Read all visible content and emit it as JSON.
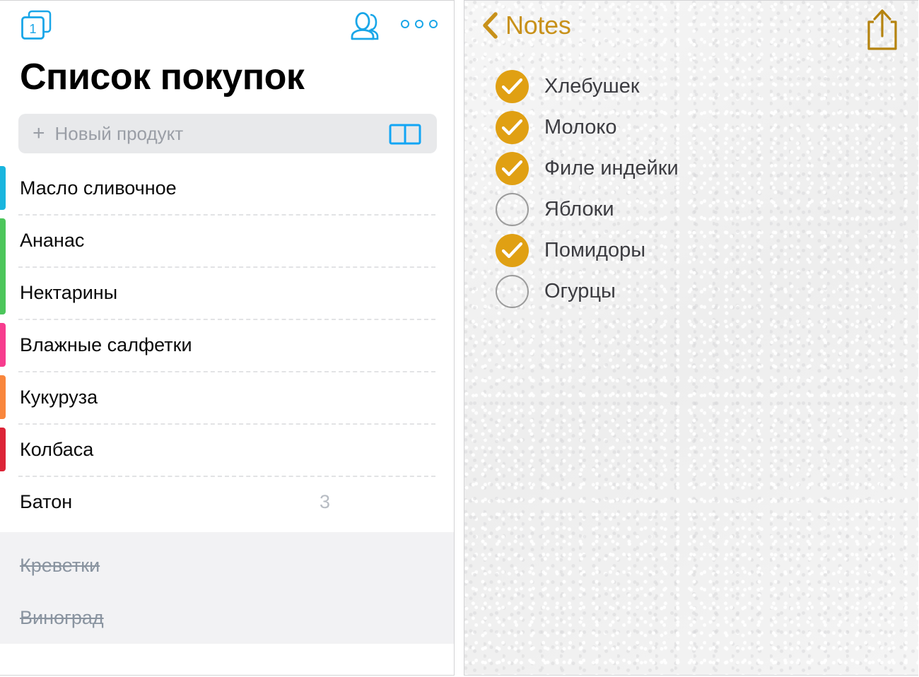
{
  "shopping_list": {
    "toolbar": {
      "stack_icon": "list-stack-icon",
      "stack_badge": "1",
      "people_icon": "people-icon",
      "more_icon": "more-options-icon"
    },
    "title": "Список покупок",
    "new_item": {
      "plus": "+",
      "placeholder": "Новый продукт",
      "book_icon": "open-book-icon"
    },
    "items": [
      {
        "label": "Масло сливочное",
        "qty": "",
        "color": "#19B5DE"
      },
      {
        "label": "Ананас",
        "qty": "",
        "color": "#4CC65B"
      },
      {
        "label": "Нектарины",
        "qty": "",
        "color": "#4CC65B"
      },
      {
        "label": "Влажные салфетки",
        "qty": "",
        "color": "#F73C8E"
      },
      {
        "label": "Кукуруза",
        "qty": "",
        "color": "#F9863C"
      },
      {
        "label": "Колбаса",
        "qty": "",
        "color": "#DC2437"
      },
      {
        "label": "Батон",
        "qty": "3",
        "color": ""
      }
    ],
    "completed": [
      {
        "label": "Креветки"
      },
      {
        "label": "Виноград"
      }
    ]
  },
  "notes": {
    "toolbar": {
      "back_icon": "chevron-left-icon",
      "back_label": "Notes",
      "share_icon": "share-icon"
    },
    "checklist": [
      {
        "label": "Хлебушек",
        "checked": true
      },
      {
        "label": "Молоко",
        "checked": true
      },
      {
        "label": "Филе индейки",
        "checked": true
      },
      {
        "label": "Яблоки",
        "checked": false
      },
      {
        "label": "Помидоры",
        "checked": true
      },
      {
        "label": "Огурцы",
        "checked": false
      }
    ]
  },
  "colors": {
    "accent_blue": "#19A6E8",
    "accent_amber": "#c8911a",
    "check_fill": "#e0a013"
  }
}
